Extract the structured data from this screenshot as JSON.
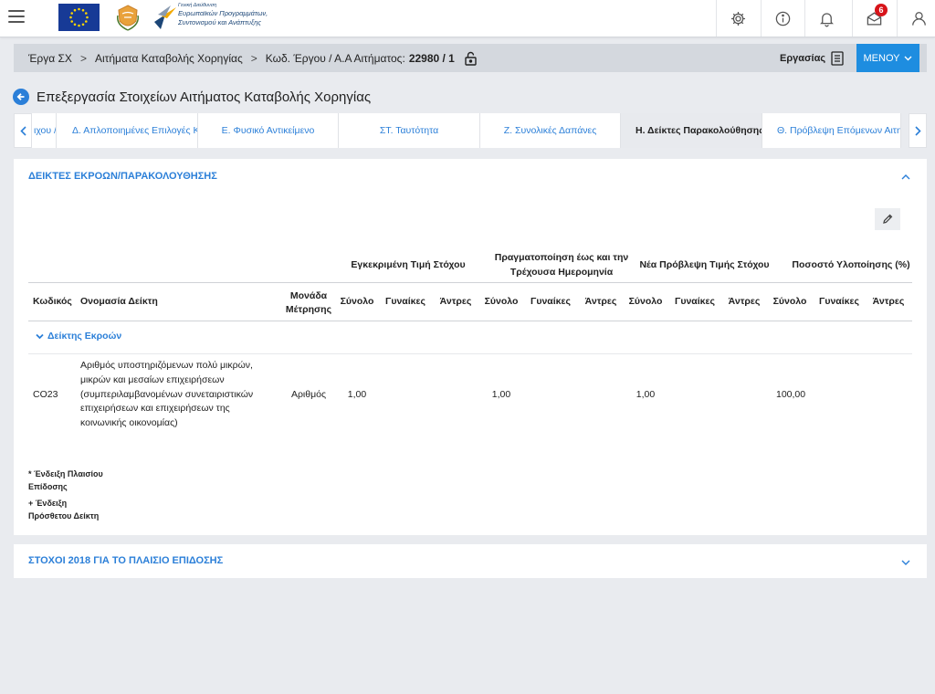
{
  "topbar": {
    "logo_text": [
      "Γενική Διεύθυνση",
      "Ευρωπαϊκών Προγραμμάτων,",
      "Συντονισμού και Ανάπτυξης"
    ],
    "icons": [
      "menu-icon",
      "eu-flag-icon",
      "cyprus-emblem-icon",
      "gear-icon",
      "info-icon",
      "bell-icon",
      "mail-icon",
      "user-icon"
    ],
    "mail_badge": "6"
  },
  "breadcrumb": {
    "items": [
      "Έργα ΣΧ",
      "Αιτήματα Καταβολής Χορηγίας",
      "Κωδ. Έργου / Α.Α Αιτήματος:"
    ],
    "code": "22980 / 1",
    "separator": ">",
    "ergasias_label": "Εργασίας",
    "menu_label": "ΜΕΝΟΥ"
  },
  "page_title": "Επεξεργασία Στοιχείων Αιτήματος Καταβολής Χορηγίας",
  "tabs": [
    {
      "label": "ιχου /"
    },
    {
      "label": "Δ. Απλοποιημένες Επιλογές Κ"
    },
    {
      "label": "Ε. Φυσικό Αντικείμενο"
    },
    {
      "label": "ΣΤ. Ταυτότητα"
    },
    {
      "label": "Ζ. Συνολικές Δαπάνες"
    },
    {
      "label": "Η. Δείκτες Παρακολούθησης",
      "active": true
    },
    {
      "label": "Θ. Πρόβλεψη Επόμενων Αιτημάτ"
    }
  ],
  "panel1": {
    "title": "ΔΕΙΚΤΕΣ ΕΚΡΟΩΝ/ΠΑΡΑΚΟΛΟΥΘΗΣΗΣ",
    "group_headers": [
      "Εγκεκριμένη Τιμή Στόχου",
      "Πραγματοποίηση έως και την Τρέχουσα Ημερομηνία",
      "Νέα Πρόβλεψη Τιμής Στόχου",
      "Ποσοστό Υλοποίησης (%)"
    ],
    "col_code": "Κωδικός",
    "col_name": "Ονομασία Δείκτη",
    "col_unit": "Μονάδα Μέτρησης",
    "sub_headers": [
      "Σύνολο",
      "Γυναίκες",
      "Άντρες"
    ],
    "group_row_label": "Δείκτης Εκροών",
    "rows": [
      {
        "code": "CO23",
        "name": "Αριθμός υποστηριζόμενων πολύ μικρών, μικρών και μεσαίων επιχειρήσεων (συμπεριλαμβανομένων συνεταιριστικών επιχειρήσεων και επιχειρήσεων της κοινωνικής οικονομίας)",
        "unit": "Αριθμός",
        "approved_total": "1,00",
        "achieved_total": "1,00",
        "forecast_total": "1,00",
        "percent_total": "100,00"
      }
    ],
    "notes": [
      "* Ένδειξη Πλαισίου Επίδοσης",
      "+ Ένδειξη Πρόσθετου Δείκτη"
    ]
  },
  "panel2": {
    "title": "ΣΤΟΧΟΙ 2018 ΓΙΑ ΤΟ ΠΛΑΙΣΙΟ ΕΠΙΔΟΣΗΣ"
  }
}
